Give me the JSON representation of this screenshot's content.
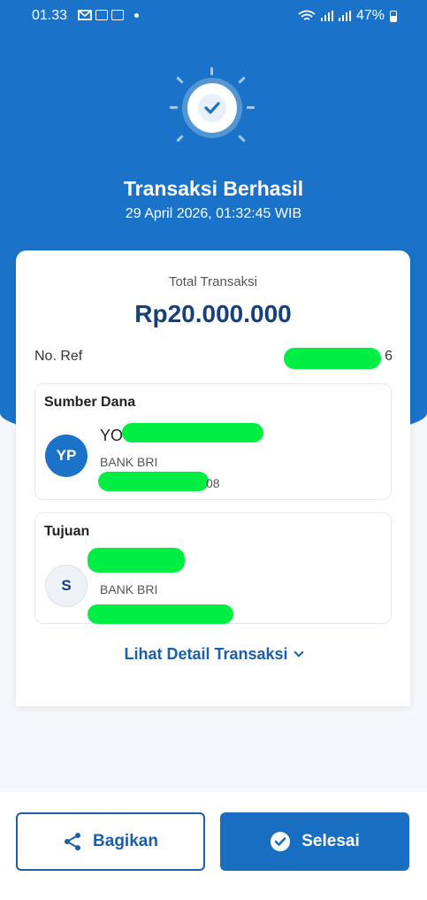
{
  "status_bar": {
    "time": "01.33",
    "battery": "47%"
  },
  "header": {
    "title": "Transaksi Berhasil",
    "datetime": "29 April 2026, 01:32:45 WIB"
  },
  "summary": {
    "total_label": "Total Transaksi",
    "total_amount": "Rp20.000.000",
    "ref_label": "No. Ref",
    "ref_suffix": "6"
  },
  "source": {
    "section_label": "Sumber Dana",
    "initials": "YP",
    "name_prefix": "YO",
    "bank": "BANK BRI",
    "account_suffix": "08"
  },
  "destination": {
    "section_label": "Tujuan",
    "initials": "S",
    "bank": "BANK BRI"
  },
  "detail_link": "Lihat Detail Transaksi",
  "actions": {
    "share_label": "Bagikan",
    "done_label": "Selesai"
  },
  "colors": {
    "primary": "#1a73c8",
    "dark_text": "#15407a",
    "mask": "#00ee44"
  }
}
